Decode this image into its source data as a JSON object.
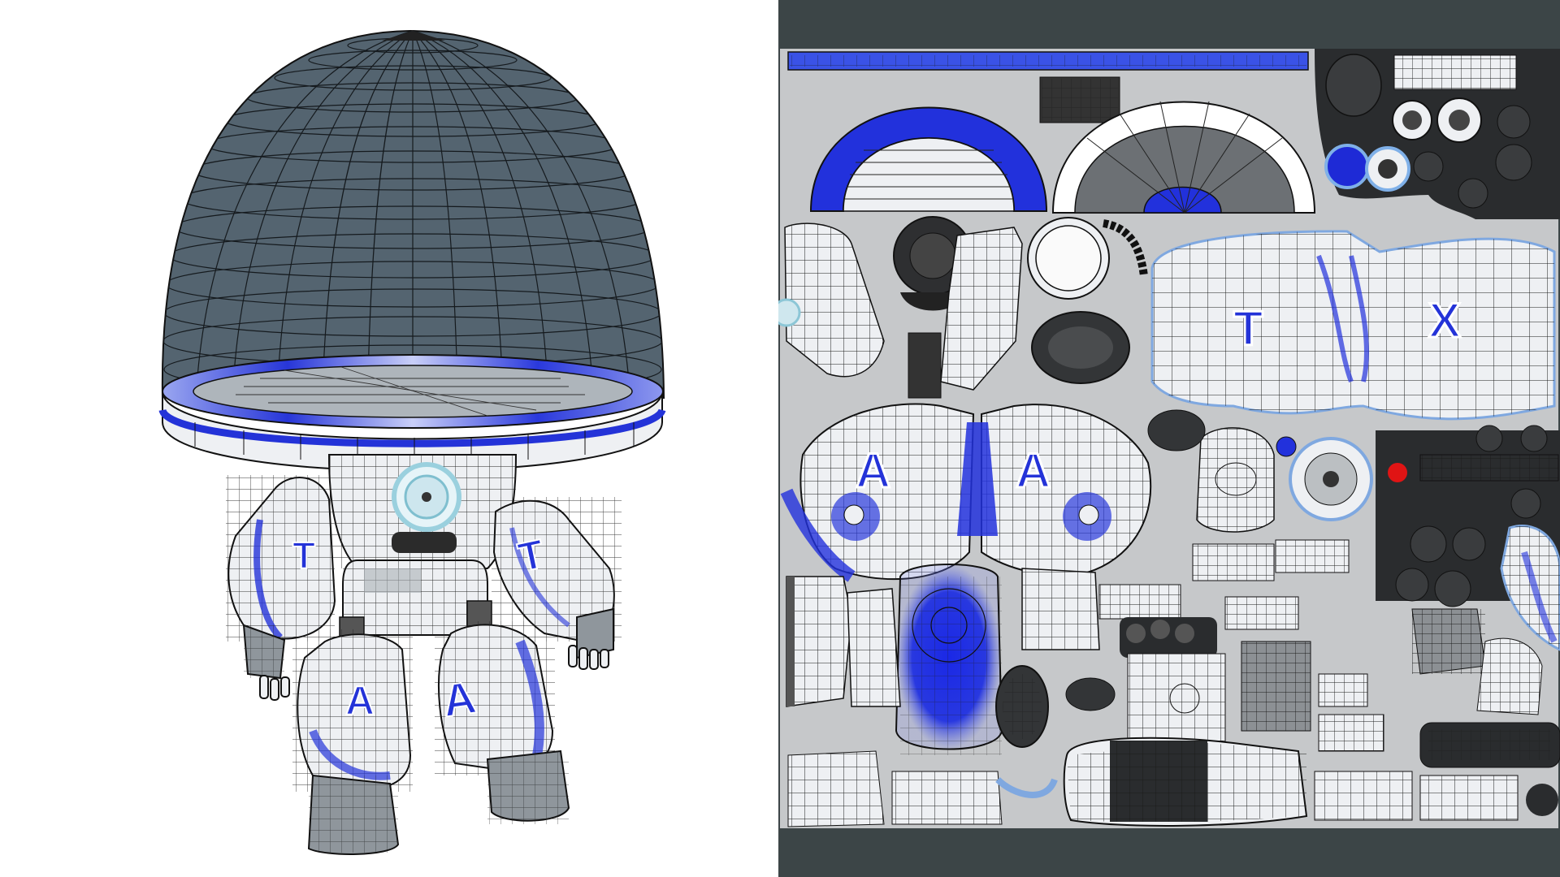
{
  "scene": {
    "left_view": "3d-model-wireframe",
    "right_view": "uv-texture-layout"
  },
  "decals": {
    "torso_left_letter": "T",
    "torso_right_letter": "X",
    "shoulder_left_letter": "A",
    "shoulder_right_letter": "A",
    "model_arm_left_letter": "T",
    "model_arm_right_letter": "T",
    "model_leg_left_letter": "A",
    "model_leg_right_letter": "A"
  },
  "colors": {
    "dome": "#4f5e68",
    "accent_blue": "#2433d8",
    "shell_white": "#eef0f3",
    "wire": "#1a1a1a",
    "uv_background": "#c6c8ca",
    "frame_dark": "#3c4547",
    "indicator_red": "#e01414",
    "dark_panel": "#2a2c2e"
  }
}
